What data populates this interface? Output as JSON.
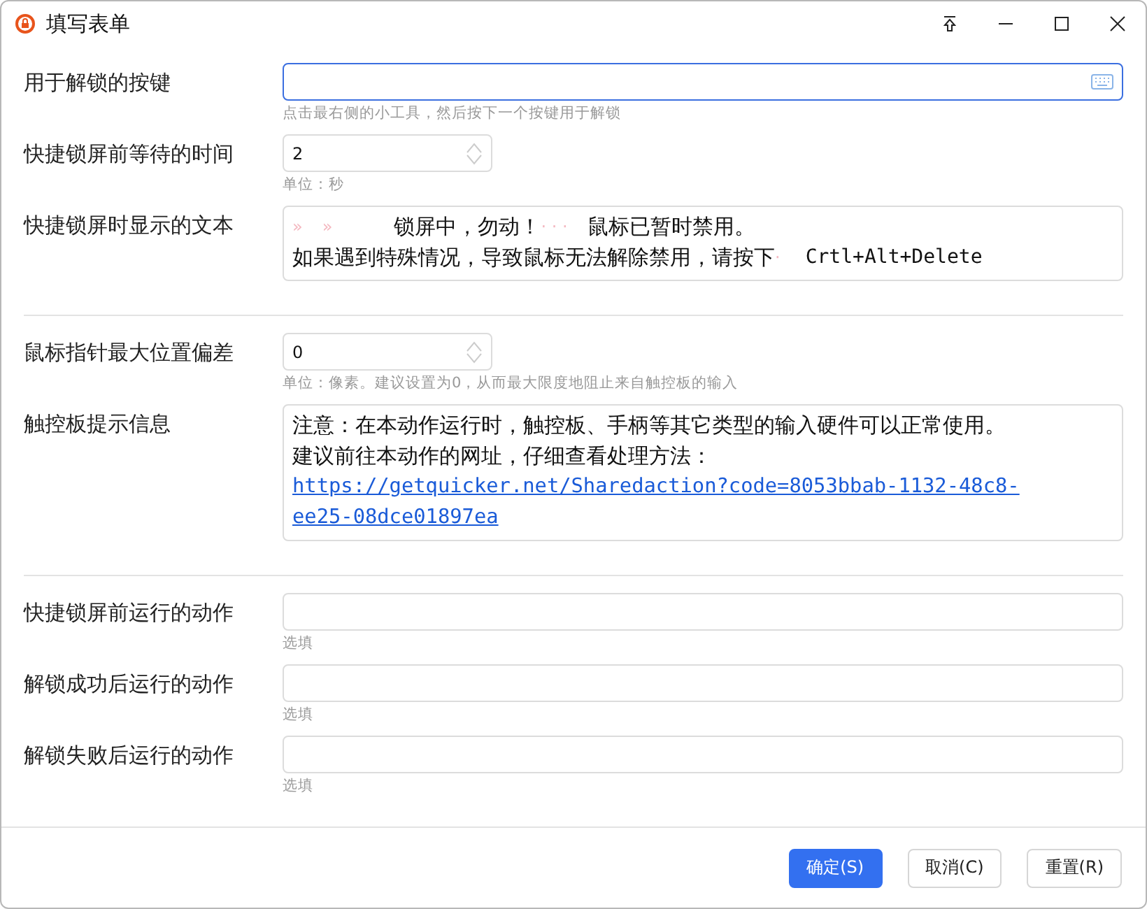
{
  "window": {
    "title": "填写表单"
  },
  "sections": [
    {
      "fields": [
        {
          "kind": "key",
          "label": "用于解锁的按键",
          "hint": "点击最右侧的小工具，然后按下一个按键用于解锁",
          "focused": true
        },
        {
          "kind": "number",
          "label": "快捷锁屏前等待的时间",
          "value": "2",
          "hint": "单位：秒",
          "focused": false
        },
        {
          "kind": "textarea",
          "label": "快捷锁屏时显示的文本",
          "focused": false,
          "lines": [
            [
              {
                "kind": "mark",
                "text": "»"
              },
              {
                "kind": "mark",
                "text": "»"
              },
              {
                "kind": "gap"
              },
              {
                "kind": "text",
                "text": "锁屏中，勿动！"
              },
              {
                "kind": "mark",
                "text": "· · ·"
              },
              {
                "kind": "text",
                "text": "鼠标已暂时禁用。"
              }
            ],
            [
              {
                "kind": "text",
                "text": "如果遇到特殊情况，导致鼠标无法解除禁用，请按下"
              },
              {
                "kind": "mark",
                "text": "·"
              },
              {
                "kind": "mono",
                "text": "Crtl+Alt+Delete"
              }
            ]
          ]
        }
      ]
    },
    {
      "fields": [
        {
          "kind": "number",
          "label": "鼠标指针最大位置偏差",
          "value": "0",
          "hint": "单位：像素。建议设置为0，从而最大限度地阻止来自触控板的输入",
          "focused": false
        },
        {
          "kind": "textarea",
          "label": "触控板提示信息",
          "focused": false,
          "lines": [
            [
              {
                "kind": "text",
                "text": "注意：在本动作运行时，触控板、手柄等其它类型的输入硬件可以正常使用。"
              }
            ],
            [
              {
                "kind": "text",
                "text": "建议前往本动作的网址，仔细查看处理方法："
              }
            ],
            [
              {
                "kind": "link",
                "text": "https://getquicker.net/Sharedaction?code=8053bbab-1132-48c8-"
              }
            ],
            [
              {
                "kind": "link",
                "text": "ee25-08dce01897ea"
              }
            ]
          ]
        }
      ]
    },
    {
      "fields": [
        {
          "kind": "text",
          "label": "快捷锁屏前运行的动作",
          "hint": "选填",
          "focused": false
        },
        {
          "kind": "text",
          "label": "解锁成功后运行的动作",
          "hint": "选填",
          "focused": false
        },
        {
          "kind": "text",
          "label": "解锁失败后运行的动作",
          "hint": "选填",
          "focused": false
        }
      ]
    }
  ],
  "buttons": [
    {
      "label": "确定(S)",
      "primary": true
    },
    {
      "label": "取消(C)",
      "primary": false
    },
    {
      "label": "重置(R)",
      "primary": false
    }
  ]
}
